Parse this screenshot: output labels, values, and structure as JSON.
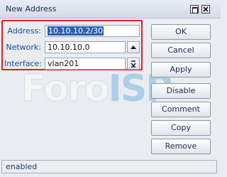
{
  "window": {
    "title": "New Address"
  },
  "form": {
    "address_label": "Address:",
    "address_value": "10.10.10.2/30",
    "network_label": "Network:",
    "network_value": "10.10.10.0",
    "interface_label": "Interface:",
    "interface_value": "vlan201"
  },
  "buttons": {
    "ok": "OK",
    "cancel": "Cancel",
    "apply": "Apply",
    "disable": "Disable",
    "comment": "Comment",
    "copy": "Copy",
    "remove": "Remove"
  },
  "watermark": {
    "part1": "Foro",
    "part2": "ISP"
  },
  "status": {
    "text": "enabled"
  },
  "colors": {
    "highlight_border": "#e02020",
    "selection": "#2d5fb4"
  }
}
